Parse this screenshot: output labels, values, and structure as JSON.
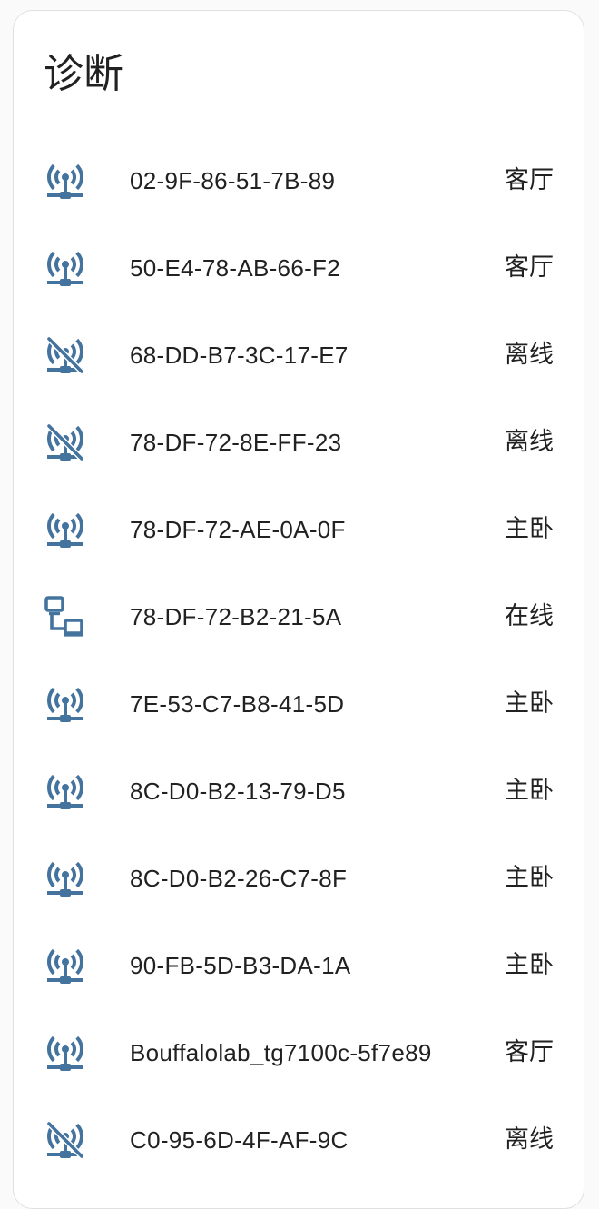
{
  "card": {
    "title": "诊断"
  },
  "colors": {
    "icon": "#44739e",
    "text": "#212121",
    "card_background": "#ffffff",
    "card_border": "#e0e0e0",
    "page_background": "#fafafa"
  },
  "entities": [
    {
      "name": "02-9F-86-51-7B-89",
      "state": "客厅",
      "icon": "wifi-access-point-network-icon"
    },
    {
      "name": "50-E4-78-AB-66-F2",
      "state": "客厅",
      "icon": "wifi-access-point-network-icon"
    },
    {
      "name": "68-DD-B7-3C-17-E7",
      "state": "离线",
      "icon": "wifi-access-point-network-off-icon"
    },
    {
      "name": "78-DF-72-8E-FF-23",
      "state": "离线",
      "icon": "wifi-access-point-network-off-icon"
    },
    {
      "name": "78-DF-72-AE-0A-0F",
      "state": "主卧",
      "icon": "wifi-access-point-network-icon"
    },
    {
      "name": "78-DF-72-B2-21-5A",
      "state": "在线",
      "icon": "lan-network-icon"
    },
    {
      "name": "7E-53-C7-B8-41-5D",
      "state": "主卧",
      "icon": "wifi-access-point-network-icon"
    },
    {
      "name": "8C-D0-B2-13-79-D5",
      "state": "主卧",
      "icon": "wifi-access-point-network-icon"
    },
    {
      "name": "8C-D0-B2-26-C7-8F",
      "state": "主卧",
      "icon": "wifi-access-point-network-icon"
    },
    {
      "name": "90-FB-5D-B3-DA-1A",
      "state": "主卧",
      "icon": "wifi-access-point-network-icon"
    },
    {
      "name": "Bouffalolab_tg7100c-5f7e89",
      "state": "客厅",
      "icon": "wifi-access-point-network-icon"
    },
    {
      "name": "C0-95-6D-4F-AF-9C",
      "state": "离线",
      "icon": "wifi-access-point-network-off-icon"
    }
  ]
}
